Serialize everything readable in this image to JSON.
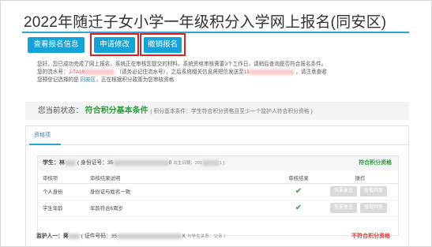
{
  "page": {
    "title": "2022年随迁子女小学一年级积分入学网上报名(同安区)",
    "accent_color": "#14a3d8",
    "highlight_color": "#e02020"
  },
  "toolbar": {
    "view_label": "查看报名信息",
    "modify_label": "申请修改",
    "cancel_label": "撤销报名"
  },
  "notice": {
    "line1": "您好，您已成功完成了网上报名，系统正在审核您提交的材料。系统资格审核需要3个工作日，请稍后查询是否符合报名条件。",
    "line2_a": "您的流水号：",
    "serial_prefix": "J-TA19",
    "line2_b": "（请务必记住流水号），之后系统相关信息将短信发送至",
    "phone_prefix": "15",
    "line2_c": "，请注意查收",
    "line3_a": "您预登记选择的是",
    "district": "同安区",
    "line3_b": "，正在根据积分政策为您审核资格"
  },
  "status": {
    "label": "您当前状态：",
    "value": "符合积分基本条件",
    "note": "( 积分基本条件：学生符合积分资格且至少一个监护人符合积分资格 )"
  },
  "tabs": {
    "review": "资格项"
  },
  "student": {
    "name_label": "学生：林",
    "id_label": "( 身份证号：35",
    "id_suffix": "0",
    "dob_label": "出生日期：201",
    "dob_suffix": "1 )",
    "result": "符合积分资格"
  },
  "table": {
    "headers": [
      "审核项",
      "审核结果说明",
      "审核结果",
      "操作"
    ],
    "rows": [
      {
        "item": "个人身份",
        "desc": "身份证与姓名一致",
        "result": "✔",
        "btn1": "我要复查",
        "btn2": "查看回复"
      },
      {
        "item": "学生年龄",
        "desc": "年龄符合6周岁",
        "result": "✔",
        "btn1": "我要复查",
        "btn2": "查看回复"
      }
    ]
  },
  "guardian": {
    "name_label": "监护人一：蒋",
    "id_label": "( 证件号码：35",
    "id_suffix": "X",
    "relation": "与学生关系：父亲 )",
    "result": "不符合积分资格"
  }
}
